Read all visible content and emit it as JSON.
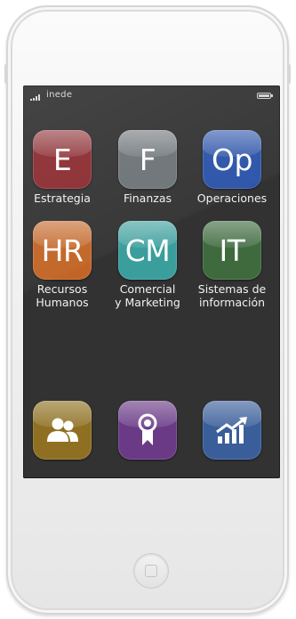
{
  "status_bar": {
    "carrier": "inede"
  },
  "apps": [
    {
      "letter": "E",
      "label": "Estrategia",
      "color": "#8a2a2f"
    },
    {
      "letter": "F",
      "label": "Finanzas",
      "color": "#6b7276"
    },
    {
      "letter": "Op",
      "label": "Operaciones",
      "color": "#2a52a8"
    },
    {
      "letter": "HR",
      "label": "Recursos\nHumanos",
      "color": "#c26425"
    },
    {
      "letter": "CM",
      "label": "Comercial\ny Marketing",
      "color": "#3a9e9c"
    },
    {
      "letter": "IT",
      "label": "Sistemas de\ninformación",
      "color": "#3e6a3e"
    }
  ],
  "dock": [
    {
      "icon": "users-icon",
      "color": "#8f7022"
    },
    {
      "icon": "award-icon",
      "color": "#6a3a86"
    },
    {
      "icon": "growth-chart-icon",
      "color": "#3a5e9a"
    }
  ]
}
